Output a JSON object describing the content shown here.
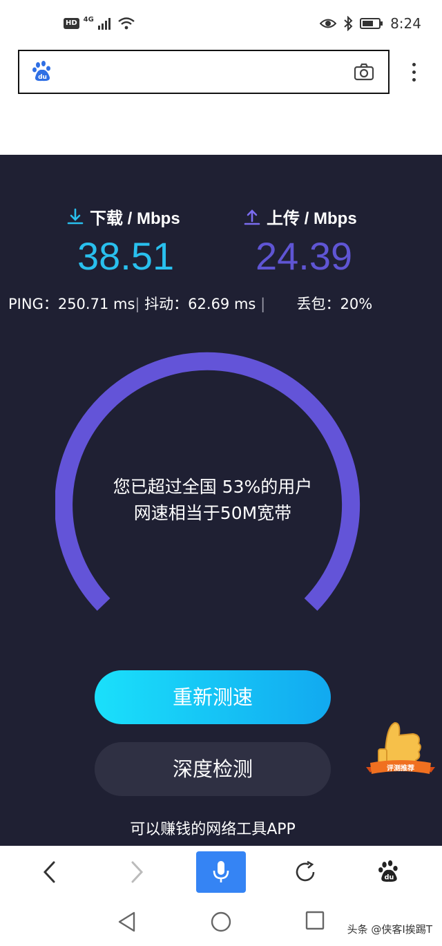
{
  "status_bar": {
    "hd": "HD",
    "network": "4G",
    "time": "8:24",
    "icons": [
      "hd-icon",
      "signal-icon",
      "wifi-icon",
      "eye-icon",
      "bluetooth-icon",
      "battery-icon"
    ]
  },
  "address_bar": {
    "logo": "baidu-logo-icon",
    "logo_text": "du",
    "value": "",
    "camera": "camera-icon",
    "menu": "more-vert-icon"
  },
  "speed": {
    "download_label": "下载 / Mbps",
    "download_value": "38.51",
    "upload_label": "上传 / Mbps",
    "upload_value": "24.39",
    "ping": "PING：250.71 ms",
    "jitter": "抖动：62.69 ms",
    "loss": "丢包：20%",
    "sep": "|",
    "summary_line1": "您已超过全国 53%的用户",
    "summary_line2": "网速相当于50M宽带",
    "gauge_fill": 1.0,
    "colors": {
      "download": "#29c0ee",
      "upload": "#5f55d4",
      "gauge": "#6354d8",
      "panel_bg": "#1f2033"
    }
  },
  "actions": {
    "retest": "重新测速",
    "deep_check": "深度检测",
    "footer": "可以赚钱的网络工具APP",
    "badge_text": "评测推荐"
  },
  "bottom_toolbar": {
    "items": [
      "back-arrow-icon",
      "forward-arrow-icon",
      "microphone-icon",
      "refresh-icon",
      "baidu-paw-icon"
    ]
  },
  "nav_bar": {
    "watermark": "头条 @侠客I挨踢T"
  }
}
